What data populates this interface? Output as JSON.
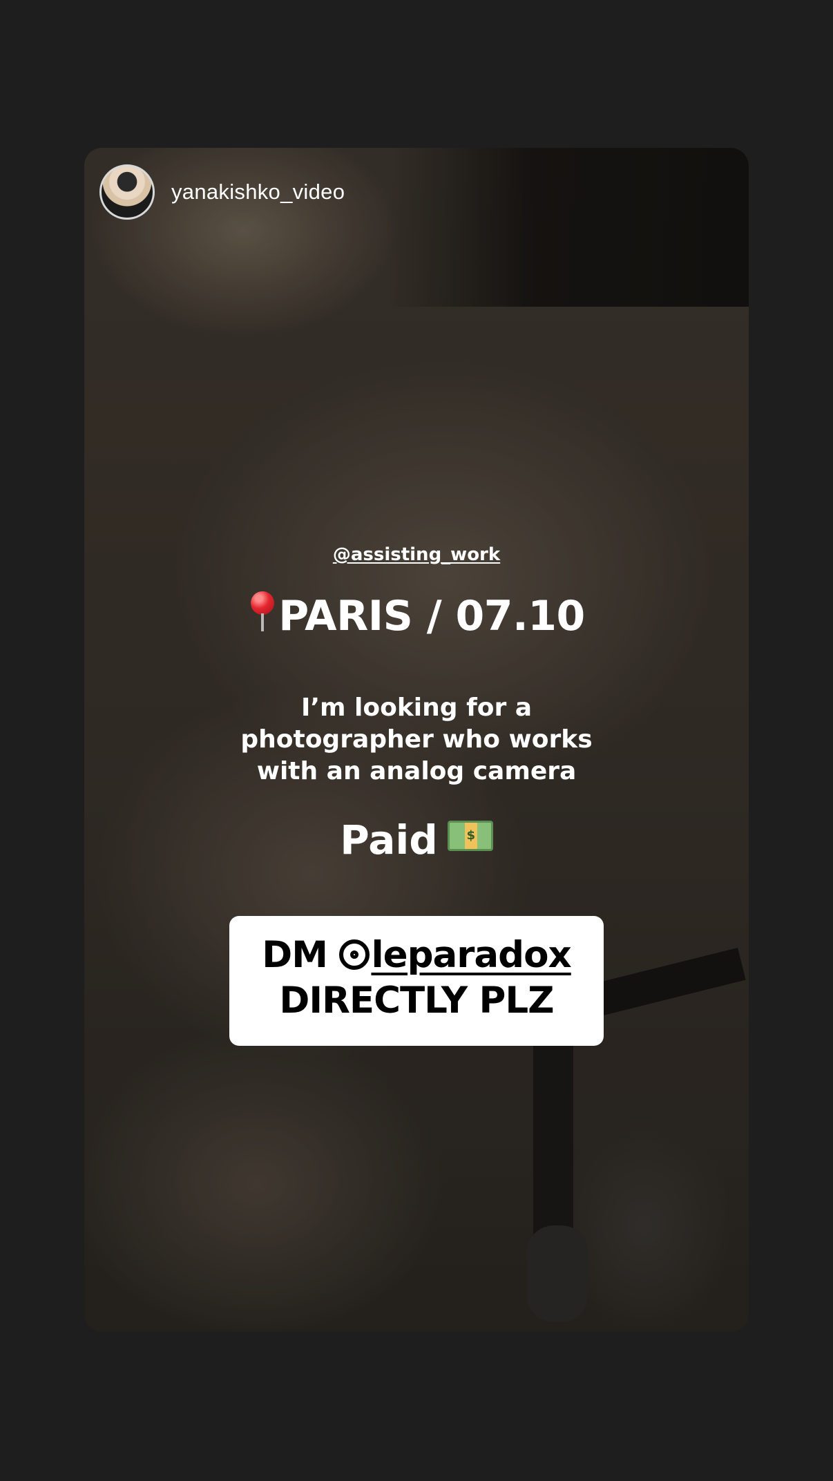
{
  "story": {
    "username": "yanakishko_video",
    "mention": "@assisting_work",
    "headline": "PARIS / 07.10",
    "headline_emoji": "round-pushpin-icon",
    "body_lines": [
      "I’m looking for a",
      "photographer who works",
      "with an analog camera"
    ],
    "paid_label": "Paid",
    "paid_emoji": "dollar-banknote-icon",
    "money_symbol": "$",
    "dm_prefix": "DM ",
    "dm_handle": "leparadox",
    "dm_handle_icon": "threads-icon",
    "dm_line2": "DIRECTLY PLZ"
  },
  "colors": {
    "page_background": "#1e1e1e",
    "text": "#ffffff",
    "dm_box_background": "#ffffff",
    "dm_text": "#000000",
    "pin_red": "#e3262f"
  }
}
